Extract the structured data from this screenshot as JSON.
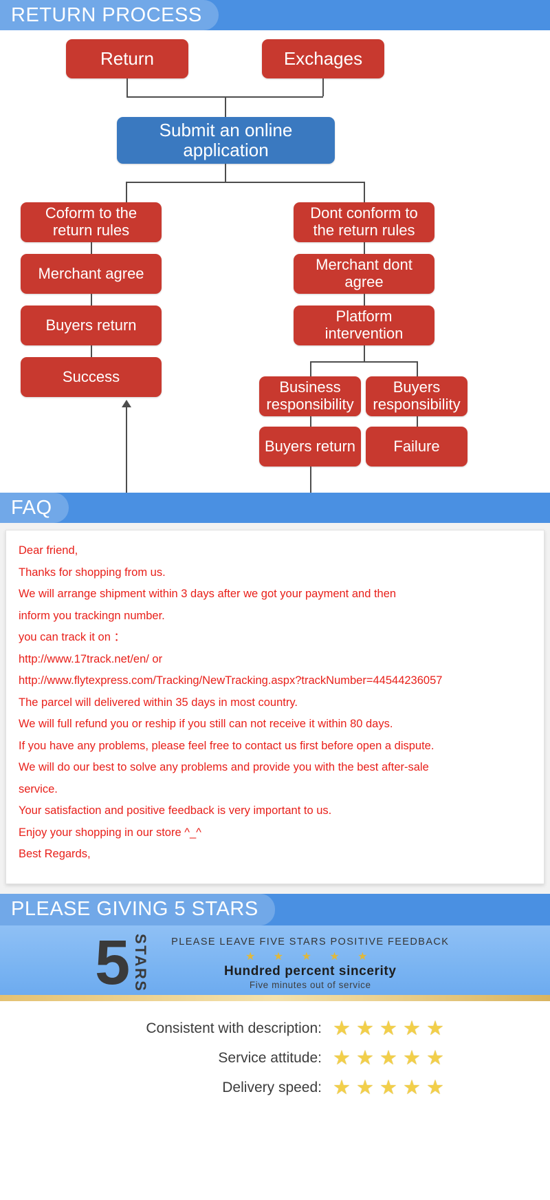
{
  "colors": {
    "bar_blue": "#4a90e2",
    "node_red": "#c8392f",
    "node_blue": "#3a79c0",
    "faq_red": "#e8201a",
    "star_gold": "#f2cf4a"
  },
  "sections": {
    "return_process": {
      "title": "RETURN PROCESS"
    },
    "faq": {
      "title": "FAQ"
    },
    "stars": {
      "title": "PLEASE GIVING 5 STARS"
    }
  },
  "flowchart": {
    "nodes": [
      {
        "id": "return",
        "label": "Return"
      },
      {
        "id": "exchages",
        "label": "Exchages"
      },
      {
        "id": "submit",
        "label": "Submit an online application"
      },
      {
        "id": "conform",
        "label": "Coform to the return rules"
      },
      {
        "id": "merchant_agree",
        "label": "Merchant agree"
      },
      {
        "id": "buyers_return_l",
        "label": "Buyers return"
      },
      {
        "id": "success",
        "label": "Success"
      },
      {
        "id": "dont_conform",
        "label": "Dont conform to the return rules"
      },
      {
        "id": "merchant_dont",
        "label": "Merchant dont agree"
      },
      {
        "id": "platform",
        "label": "Platform intervention"
      },
      {
        "id": "business_resp",
        "label": "Business responsibility"
      },
      {
        "id": "buyers_resp",
        "label": "Buyers responsibility"
      },
      {
        "id": "buyers_return_r",
        "label": "Buyers return"
      },
      {
        "id": "failure",
        "label": "Failure"
      }
    ]
  },
  "faq": {
    "lines": [
      "Dear friend,",
      "Thanks for shopping from us.",
      "We will arrange shipment within 3 days after we got your payment and then",
      "inform you trackingn number.",
      "you can track it on ：",
      "http://www.17track.net/en/                        or",
      "http://www.flytexpress.com/Tracking/NewTracking.aspx?trackNumber=44544236057",
      "The parcel will delivered within 35 days in most country.",
      "We will full refund you or reship if you still can not receive it within 80 days.",
      "If you have any problems, please feel free to contact us first before open a dispute.",
      "We will do our best to solve any problems and provide you with the best after-sale",
      "service.",
      "Your satisfaction and positive feedback is very important to us.",
      "Enjoy your shopping in our store ^_^",
      "Best Regards,"
    ]
  },
  "stars_banner": {
    "number": "5",
    "vertical_word": "STARS",
    "headline": "PLEASE LEAVE FIVE STARS POSITIVE FEEDBACK",
    "star_row": "★ ★ ★ ★ ★",
    "tagline": "Hundred percent sincerity",
    "subtagline": "Five minutes out of service"
  },
  "ratings": {
    "star_glyph": "★",
    "rows": [
      {
        "label": "Consistent with description:",
        "stars": 5
      },
      {
        "label": "Service attitude:",
        "stars": 5
      },
      {
        "label": "Delivery speed:",
        "stars": 5
      }
    ]
  }
}
